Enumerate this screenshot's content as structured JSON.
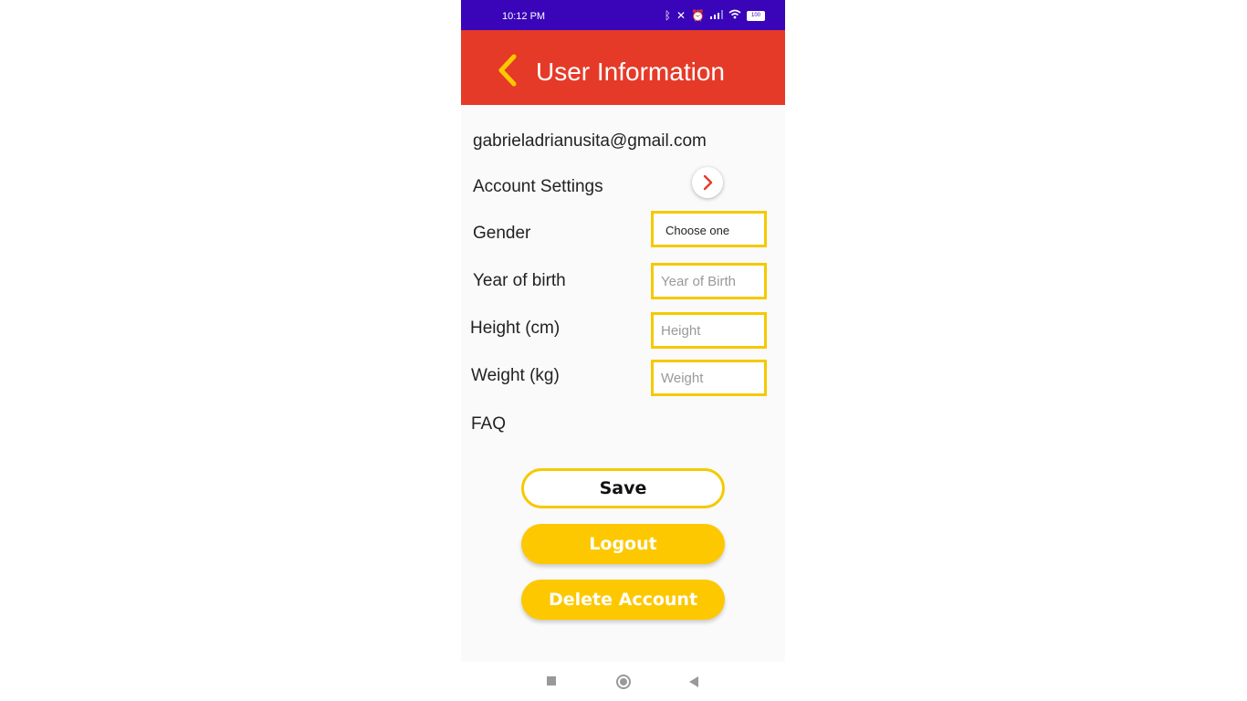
{
  "status_bar": {
    "time": "10:12 PM",
    "icons": [
      "bluetooth-icon",
      "mute-icon",
      "alarm-icon",
      "signal-icon",
      "wifi-icon",
      "battery-icon"
    ],
    "battery_level": "100"
  },
  "app_bar": {
    "title": "User Information",
    "back_icon": "chevron-left-icon",
    "background": "#e53a28",
    "icon_color": "#fdc800"
  },
  "profile": {
    "email": "gabrieladrianusita@gmail.com",
    "account_settings_label": "Account Settings"
  },
  "form": {
    "gender_label": "Gender",
    "gender_value": "Choose one",
    "year_label": "Year of birth",
    "year_placeholder": "Year of Birth",
    "height_label": "Height (cm)",
    "height_placeholder": "Height",
    "weight_label": "Weight (kg)",
    "weight_placeholder": "Weight",
    "border_color": "#f5c900"
  },
  "faq_label": "FAQ",
  "buttons": {
    "save": "Save",
    "logout": "Logout",
    "delete_account": "Delete Account",
    "accent": "#fdc800"
  },
  "nav_bar": {
    "icons": [
      "recents-square-icon",
      "home-circle-icon",
      "back-triangle-icon"
    ]
  }
}
